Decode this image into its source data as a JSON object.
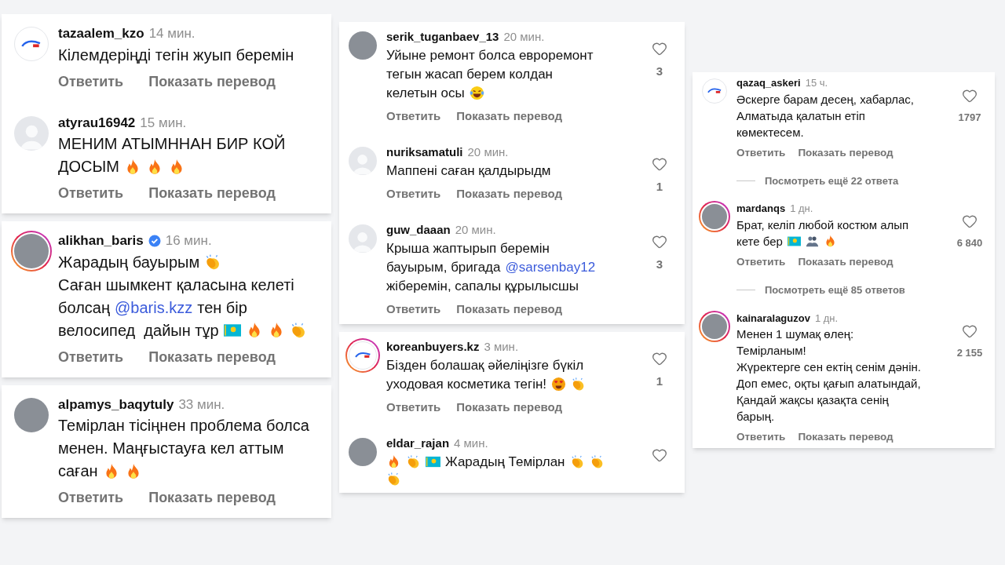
{
  "columns": [
    {
      "cards": [
        {
          "comments": [
            {
              "username": "tazaalem_kzo",
              "time": "14 мин.",
              "avatar": {
                "kind": "logo",
                "story_ring": false
              },
              "verified": false,
              "lines": [
                [
                  {
                    "kind": "text",
                    "text": "Кілемдеріңді тегін жуып беремін"
                  }
                ]
              ],
              "actions": [
                "Ответить",
                "Показать перевод"
              ]
            },
            {
              "username": "atyrau16942",
              "time": "15 мин.",
              "avatar": {
                "kind": "default",
                "story_ring": false
              },
              "verified": false,
              "lines": [
                [
                  {
                    "kind": "text",
                    "text": "МЕНИМ АТЫМННАН БИР КОЙ"
                  }
                ],
                [
                  {
                    "kind": "text",
                    "text": "ДОСЫМ"
                  },
                  {
                    "kind": "fire"
                  },
                  {
                    "kind": "fire"
                  },
                  {
                    "kind": "fire"
                  }
                ]
              ],
              "actions": [
                "Ответить",
                "Показать перевод"
              ]
            }
          ]
        },
        {
          "comments": [
            {
              "username": "alikhan_baris",
              "time": "16 мин.",
              "avatar": {
                "kind": "photo",
                "story_ring": true
              },
              "verified": true,
              "lines": [
                [
                  {
                    "kind": "text",
                    "text": "Жарадың бауырым"
                  },
                  {
                    "kind": "clap"
                  }
                ],
                [
                  {
                    "kind": "text",
                    "text": "Саған шымкент қаласына келеті"
                  }
                ],
                [
                  {
                    "kind": "text",
                    "text": "болсаң"
                  },
                  {
                    "kind": "mention",
                    "text": "@baris.kzz"
                  },
                  {
                    "kind": "text",
                    "text": "тен бір"
                  }
                ],
                [
                  {
                    "kind": "text",
                    "text": "велосипед  дайын тұр"
                  },
                  {
                    "kind": "flag"
                  },
                  {
                    "kind": "fire"
                  },
                  {
                    "kind": "fire"
                  },
                  {
                    "kind": "clap"
                  }
                ]
              ],
              "actions": [
                "Ответить",
                "Показать перевод"
              ]
            }
          ]
        },
        {
          "comments": [
            {
              "username": "alpamys_baqytuly",
              "time": "33 мин.",
              "avatar": {
                "kind": "photo",
                "story_ring": false
              },
              "verified": false,
              "lines": [
                [
                  {
                    "kind": "text",
                    "text": "Темірлан тісіңнен проблема болса"
                  }
                ],
                [
                  {
                    "kind": "text",
                    "text": "менен. Маңғыстауға кел аттым"
                  }
                ],
                [
                  {
                    "kind": "text",
                    "text": "саған"
                  },
                  {
                    "kind": "fire"
                  },
                  {
                    "kind": "fire"
                  }
                ]
              ],
              "actions": [
                "Ответить",
                "Показать перевод"
              ]
            }
          ]
        }
      ]
    },
    {
      "cards": [
        {
          "comments": [
            {
              "username": "serik_tuganbaev_13",
              "time": "20 мин.",
              "avatar": {
                "kind": "photo",
                "story_ring": false
              },
              "verified": false,
              "like_button": true,
              "like_count": "3",
              "lines": [
                [
                  {
                    "kind": "text",
                    "text": "Уйыне ремонт болса евроремонт"
                  }
                ],
                [
                  {
                    "kind": "text",
                    "text": "тегын жасап берем колдан"
                  }
                ],
                [
                  {
                    "kind": "text",
                    "text": "келетын осы"
                  },
                  {
                    "kind": "laugh"
                  }
                ]
              ],
              "actions": [
                "Ответить",
                "Показать перевод"
              ]
            },
            {
              "username": "nuriksamatuli",
              "time": "20 мин.",
              "avatar": {
                "kind": "default",
                "story_ring": false
              },
              "verified": false,
              "like_button": true,
              "like_count": "1",
              "lines": [
                [
                  {
                    "kind": "text",
                    "text": "Маппені саған қалдырыдм"
                  }
                ]
              ],
              "actions": [
                "Ответить",
                "Показать перевод"
              ]
            },
            {
              "username": "guw_daaan",
              "time": "20 мин.",
              "avatar": {
                "kind": "default",
                "story_ring": false
              },
              "verified": false,
              "like_button": true,
              "like_count": "3",
              "lines": [
                [
                  {
                    "kind": "text",
                    "text": "Крыша жаптырып беремін"
                  }
                ],
                [
                  {
                    "kind": "text",
                    "text": "бауырым, бригада"
                  },
                  {
                    "kind": "mention",
                    "text": "@sarsenbay12"
                  }
                ],
                [
                  {
                    "kind": "text",
                    "text": "жіберемін, сапалы құрылысшы"
                  }
                ]
              ],
              "actions": [
                "Ответить",
                "Показать перевод"
              ]
            }
          ]
        },
        {
          "comments": [
            {
              "username": "koreanbuyers.kz",
              "time": "3 мин.",
              "avatar": {
                "kind": "logo",
                "story_ring": true
              },
              "verified": false,
              "like_button": true,
              "like_count": "1",
              "lines": [
                [
                  {
                    "kind": "text",
                    "text": "Бізден болашақ әйеліңізге бүкіл"
                  }
                ],
                [
                  {
                    "kind": "text",
                    "text": "уходовая косметика тегін!"
                  },
                  {
                    "kind": "love"
                  },
                  {
                    "kind": "clap"
                  }
                ]
              ],
              "actions": [
                "Ответить",
                "Показать перевод"
              ]
            },
            {
              "username": "eldar_rajan",
              "time": "4 мин.",
              "avatar": {
                "kind": "photo",
                "story_ring": false
              },
              "verified": false,
              "like_button": true,
              "lines": [
                [
                  {
                    "kind": "fire"
                  },
                  {
                    "kind": "clap"
                  },
                  {
                    "kind": "flag"
                  },
                  {
                    "kind": "text",
                    "text": "Жарадың Темірлан"
                  },
                  {
                    "kind": "clap"
                  },
                  {
                    "kind": "clap"
                  }
                ],
                [
                  {
                    "kind": "clap"
                  }
                ]
              ]
            }
          ]
        }
      ]
    },
    {
      "cards": [
        {
          "comments": [
            {
              "username": "qazaq_askeri",
              "time": "15 ч.",
              "avatar": {
                "kind": "logo",
                "story_ring": false
              },
              "verified": false,
              "like_button": true,
              "like_count": "1797",
              "lines": [
                [
                  {
                    "kind": "text",
                    "text": "Әскерге барам десең, хабарлас,"
                  }
                ],
                [
                  {
                    "kind": "text",
                    "text": "Алматыда қалатын етіп"
                  }
                ],
                [
                  {
                    "kind": "text",
                    "text": "көмектесем."
                  }
                ]
              ],
              "actions": [
                "Ответить",
                "Показать перевод"
              ],
              "more_replies": "Посмотреть ещё 22 ответа"
            },
            {
              "username": "mardanqs",
              "time": "1 дн.",
              "avatar": {
                "kind": "photo",
                "story_ring": true
              },
              "verified": false,
              "like_button": true,
              "like_count": "6 840",
              "lines": [
                [
                  {
                    "kind": "text",
                    "text": "Брат, келіп любой костюм алып"
                  }
                ],
                [
                  {
                    "kind": "text",
                    "text": "кете бер"
                  },
                  {
                    "kind": "flag"
                  },
                  {
                    "kind": "people"
                  },
                  {
                    "kind": "fire"
                  }
                ]
              ],
              "actions": [
                "Ответить",
                "Показать перевод"
              ],
              "more_replies": "Посмотреть ещё 85 ответов"
            },
            {
              "username": "kainaralaguzov",
              "time": "1 дн.",
              "avatar": {
                "kind": "photo",
                "story_ring": true
              },
              "verified": false,
              "like_button": true,
              "like_count": "2 155",
              "lines": [
                [
                  {
                    "kind": "text",
                    "text": "Менен 1 шумақ өлең:"
                  }
                ],
                [
                  {
                    "kind": "text",
                    "text": "Темірланым!"
                  }
                ],
                [
                  {
                    "kind": "text",
                    "text": "Жүректерге сен ектің сенім дәнін."
                  }
                ],
                [
                  {
                    "kind": "text",
                    "text": "Доп емес, оқты қағып алатындай,"
                  }
                ],
                [
                  {
                    "kind": "text",
                    "text": "Қандай жақсы қазақта сенің"
                  }
                ],
                [
                  {
                    "kind": "text",
                    "text": "барың."
                  }
                ]
              ],
              "actions": [
                "Ответить",
                "Показать перевод"
              ]
            }
          ]
        }
      ]
    }
  ]
}
